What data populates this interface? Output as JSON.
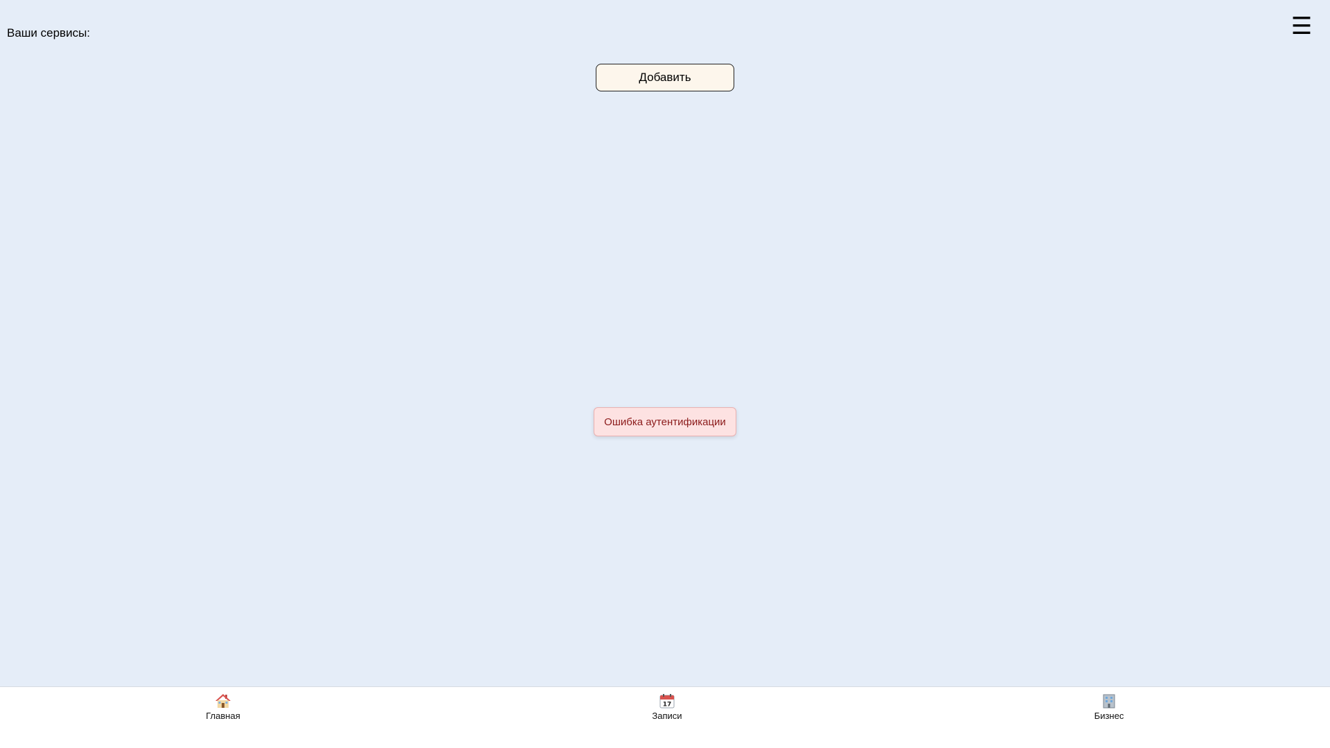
{
  "header": {
    "services_label": "Ваши сервисы:",
    "menu_icon": "hamburger-menu-icon",
    "menu_glyph": "☰"
  },
  "main": {
    "add_button_label": "Добавить"
  },
  "toast": {
    "error_text": "Ошибка аутентификации"
  },
  "bottom_nav": {
    "items": [
      {
        "label": "Главная",
        "icon": "house-icon"
      },
      {
        "label": "Записи",
        "icon": "calendar-icon"
      },
      {
        "label": "Бизнес",
        "icon": "office-building-icon"
      }
    ]
  },
  "colors": {
    "background": "#e5edf8",
    "add_button_bg": "#fdf6ec",
    "toast_bg": "#fde2e2",
    "toast_text": "#8b1a1a",
    "nav_bg": "#ffffff"
  }
}
